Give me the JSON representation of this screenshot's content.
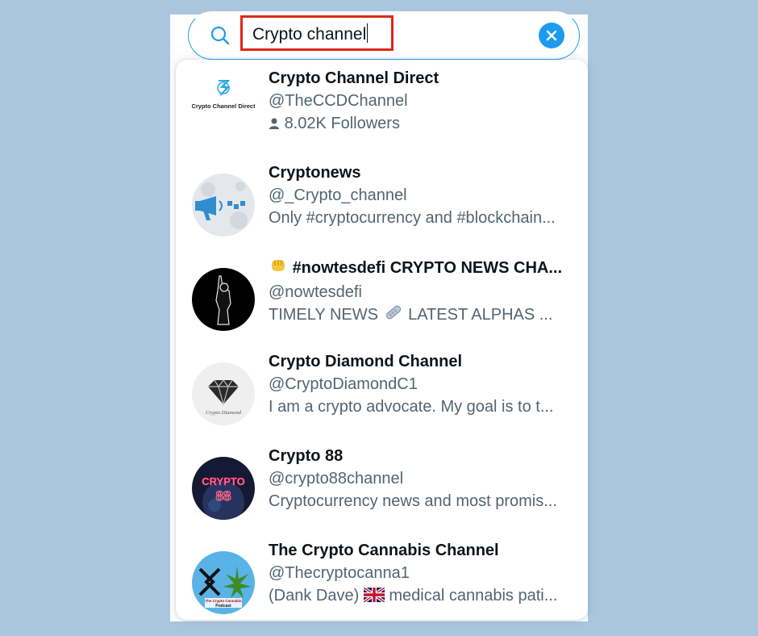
{
  "search": {
    "query": "Crypto channel"
  },
  "results": [
    {
      "name": "Crypto Channel Direct",
      "handle": "@TheCCDChannel",
      "followers": "8.02K Followers",
      "avatar_text": "Crypto Channel Direct"
    },
    {
      "name": "Cryptonews",
      "handle": "@_Crypto_channel",
      "description": "Only #cryptocurrency and #blockchain..."
    },
    {
      "name": "#nowtesdefi CRYPTO NEWS CHA...",
      "handle": "@nowtesdefi",
      "description": "TIMELY NEWS",
      "description_tail": "LATEST ALPHAS ..."
    },
    {
      "name": "Crypto Diamond Channel",
      "handle": "@CryptoDiamondC1",
      "description": "I am a crypto advocate. My goal is to t...",
      "avatar_text": "Crypto Diamond"
    },
    {
      "name": "Crypto 88",
      "handle": "@crypto88channel",
      "description": "Cryptocurrency news and most promis...",
      "avatar_text": "CRYPTO",
      "avatar_text2": "88"
    },
    {
      "name": "The Crypto Cannabis Channel",
      "handle": "@Thecryptocanna1",
      "description_head": "(Dank Dave)",
      "description": "medical cannabis pati...",
      "avatar_text": "The Crypto Cannabis",
      "avatar_text2": "Podcast"
    }
  ],
  "colors": {
    "accent": "#1d9bf0",
    "highlight_box": "#e0261c",
    "background": "#a9c6de",
    "name_text": "#0f1419",
    "secondary_text": "#536471"
  }
}
